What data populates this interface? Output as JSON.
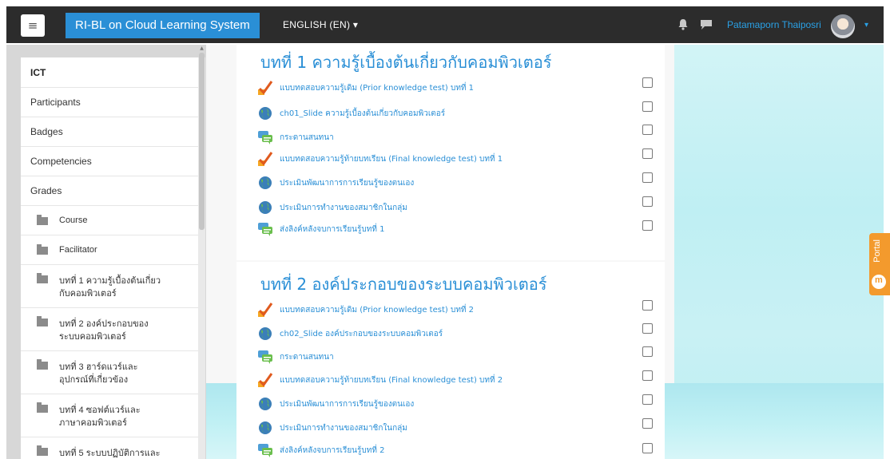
{
  "navbar": {
    "menu_icon": "≡",
    "site_name": "RI-BL on Cloud Learning System",
    "language": "ENGLISH (EN) ▾",
    "user_name": "Patamaporn Thaiposri",
    "user_caret": "▾"
  },
  "sidebar": {
    "items": [
      {
        "label": "ICT"
      },
      {
        "label": "Participants"
      },
      {
        "label": "Badges"
      },
      {
        "label": "Competencies"
      },
      {
        "label": "Grades"
      }
    ],
    "folders": [
      {
        "label": "Course"
      },
      {
        "label": "Facilitator"
      },
      {
        "label": "บทที่ 1 ความรู้เบื้องต้นเกี่ยว กับคอมพิวเตอร์"
      },
      {
        "label": "บทที่ 2 องค์ประกอบของ ระบบคอมพิวเตอร์"
      },
      {
        "label": "บทที่ 3 ฮาร์ดแวร์และ อุปกรณ์ที่เกี่ยวข้อง"
      },
      {
        "label": "บทที่ 4 ซอฟต์แวร์และ ภาษาคอมพิวเตอร์"
      },
      {
        "label": "บทที่ 5 ระบบปฏิบัติการและ"
      }
    ]
  },
  "sections": [
    {
      "title": "บทที่ 1 ความรู้เบื้องต้นเกี่ยวกับคอมพิวเตอร์",
      "activities": [
        {
          "icon": "quiz-icon",
          "label": "แบบทดสอบความรู้เดิม (Prior knowledge test) บทที่ 1"
        },
        {
          "icon": "url-globe-icon",
          "label": "ch01_Slide ความรู้เบื้องต้นเกี่ยวกับคอมพิวเตอร์"
        },
        {
          "icon": "forum-icon",
          "label": "กระดานสนทนา"
        },
        {
          "icon": "quiz-icon",
          "label": "แบบทดสอบความรู้ท้ายบทเรียน (Final knowledge test) บทที่ 1"
        },
        {
          "icon": "url-globe-icon",
          "label": "ประเมินพัฒนาการการเรียนรู้ของตนเอง"
        },
        {
          "icon": "url-globe-icon",
          "label": "ประเมินการทำงานของสมาชิกในกลุ่ม"
        },
        {
          "icon": "forum-icon",
          "label": "ส่งลิงค์หลังจบการเรียนรู้บทที่ 1"
        }
      ]
    },
    {
      "title": "บทที่ 2 องค์ประกอบของระบบคอมพิวเตอร์",
      "activities": [
        {
          "icon": "quiz-icon",
          "label": "แบบทดสอบความรู้เดิม (Prior knowledge test) บทที่ 2"
        },
        {
          "icon": "url-globe-icon",
          "label": "ch02_Slide องค์ประกอบของระบบคอมพิวเตอร์"
        },
        {
          "icon": "forum-icon",
          "label": "กระดานสนทนา"
        },
        {
          "icon": "quiz-icon",
          "label": "แบบทดสอบความรู้ท้ายบทเรียน (Final knowledge test) บทที่ 2"
        },
        {
          "icon": "url-globe-icon",
          "label": "ประเมินพัฒนาการการเรียนรู้ของตนเอง"
        },
        {
          "icon": "url-globe-icon",
          "label": "ประเมินการทำงานของสมาชิกในกลุ่ม"
        },
        {
          "icon": "forum-icon",
          "label": "ส่งลิงค์หลังจบการเรียนรู้บทที่ 2"
        }
      ]
    }
  ],
  "portal": {
    "label": "Portal"
  },
  "colors": {
    "navbar": "#2c2c2c",
    "brand": "#2a8fd6",
    "link": "#2a8fd6",
    "portal": "#f39a2d"
  }
}
